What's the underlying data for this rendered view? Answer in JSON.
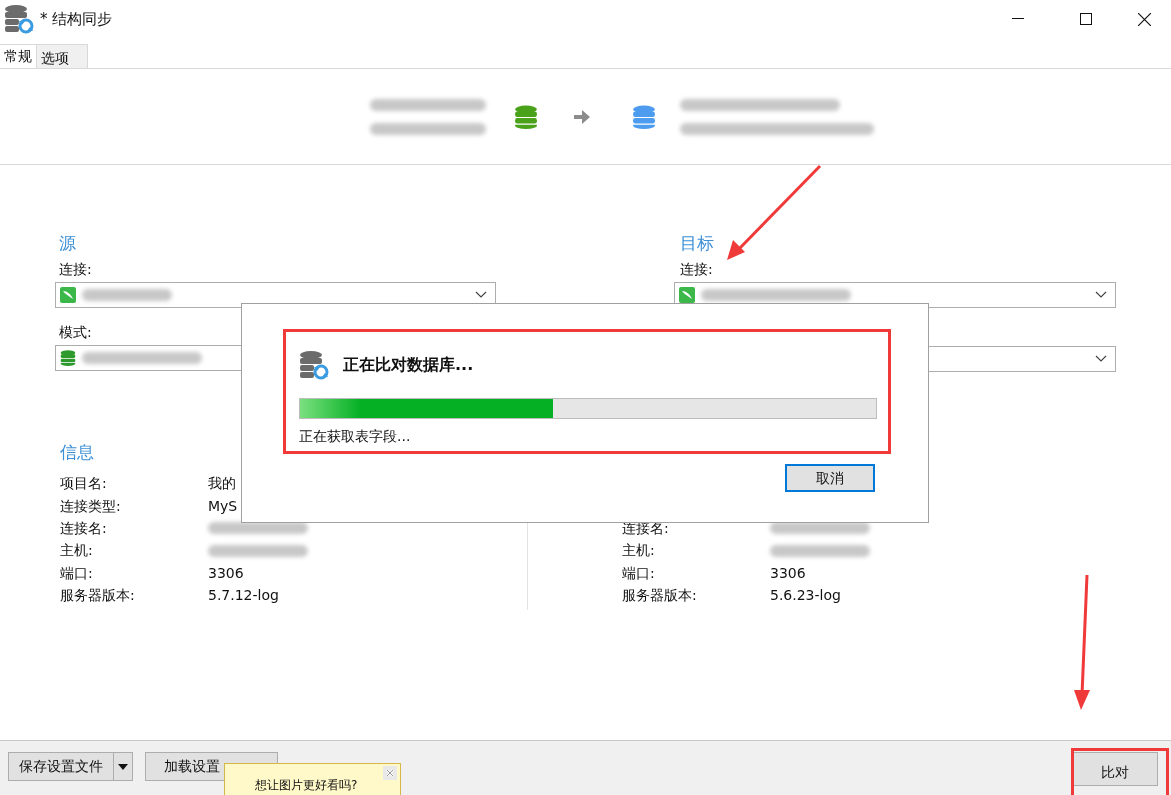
{
  "window": {
    "title": "* 结构同步"
  },
  "tabs": [
    {
      "label": "常规",
      "selected": true
    },
    {
      "label": "选项",
      "selected": false
    }
  ],
  "source": {
    "heading": "源",
    "connection_label": "连接:",
    "schema_label": "模式:"
  },
  "target": {
    "heading": "目标",
    "connection_label": "连接:"
  },
  "source_info": {
    "heading": "信息",
    "rows": [
      {
        "label": "项目名:",
        "value": "我的"
      },
      {
        "label": "连接类型:",
        "value": "MyS"
      },
      {
        "label": "连接名:"
      },
      {
        "label": "主机:"
      },
      {
        "label": "端口:",
        "value": "3306"
      },
      {
        "label": "服务器版本:",
        "value": "5.7.12-log"
      }
    ]
  },
  "target_info": {
    "rows": [
      {
        "label": "连接名:"
      },
      {
        "label": "主机:"
      },
      {
        "label": "端口:",
        "value": "3306"
      },
      {
        "label": "服务器版本:",
        "value": "5.6.23-log"
      }
    ]
  },
  "progress_dialog": {
    "title": "正在比对数据库...",
    "level": 0.44,
    "status": "正在获取表字段...",
    "cancel_button": "取消"
  },
  "footer": {
    "buttons": [
      {
        "label": "保存设置文件",
        "kind": "split"
      },
      {
        "label": "加载设置",
        "kind": "plain"
      }
    ],
    "compare_button": "比对"
  },
  "tooltip": {
    "text": "想让图片更好看吗?"
  }
}
